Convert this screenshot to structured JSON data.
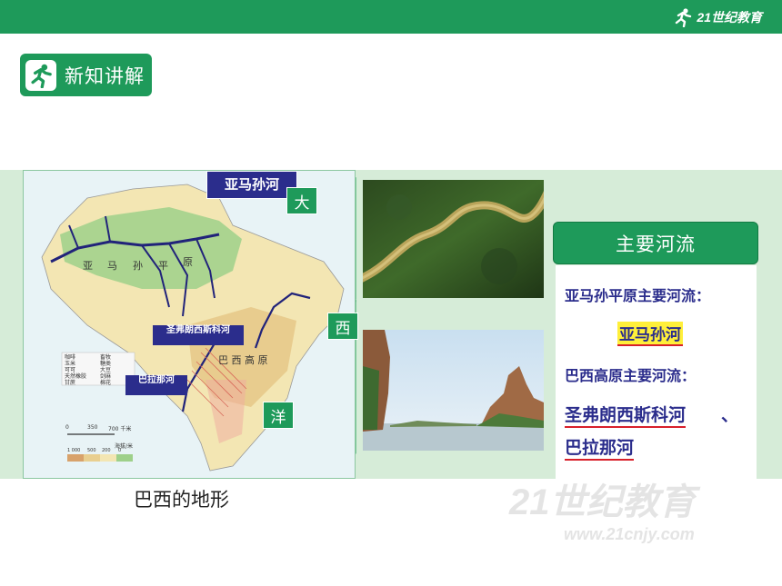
{
  "header": {
    "logo_text": "21世纪教育",
    "logo_sub": "www.21cnjy.com",
    "logo_icon": "runner-icon",
    "bar_color": "#1e9a5a"
  },
  "section": {
    "label": "新知讲解",
    "icon": "runner-icon"
  },
  "map": {
    "callouts": {
      "amazon": "亚马孙河",
      "sao_francisco": "圣弗朗西斯科河",
      "parana": "巴拉那河"
    },
    "ocean_chars": [
      "大",
      "西",
      "洋"
    ],
    "region_labels": {
      "plain": [
        "亚",
        "马",
        "孙",
        "平",
        "原"
      ],
      "plateau": "巴 西 高 原"
    },
    "scale_labels": [
      "0",
      "350",
      "700 千米"
    ],
    "elevation_title": "海拔/米",
    "elevation_values": [
      "1 000",
      "500",
      "200",
      "0"
    ],
    "legend": [
      "咖啡",
      "玉米",
      "可可",
      "天然橡胶",
      "甘蔗",
      "畜牧",
      "糖类",
      "大豆",
      "剑麻",
      "棉花"
    ]
  },
  "caption": "巴西的地形",
  "rivers": {
    "heading": "主要河流",
    "line1": "亚马孙平原主要河流：",
    "answer1": "亚马孙河",
    "line2": "巴西高原主要河流：",
    "answer2a": "圣弗朗西斯科河",
    "sep": "、",
    "answer2b": "巴拉那河"
  },
  "watermark": {
    "text": "21世纪教育",
    "sub": "www.21cnjy.com"
  },
  "colors": {
    "accent": "#1e9a5a",
    "navy": "#2b2d8c",
    "highlight": "#ffef3a",
    "underline": "#d8202a",
    "band": "#d6ecd8"
  }
}
